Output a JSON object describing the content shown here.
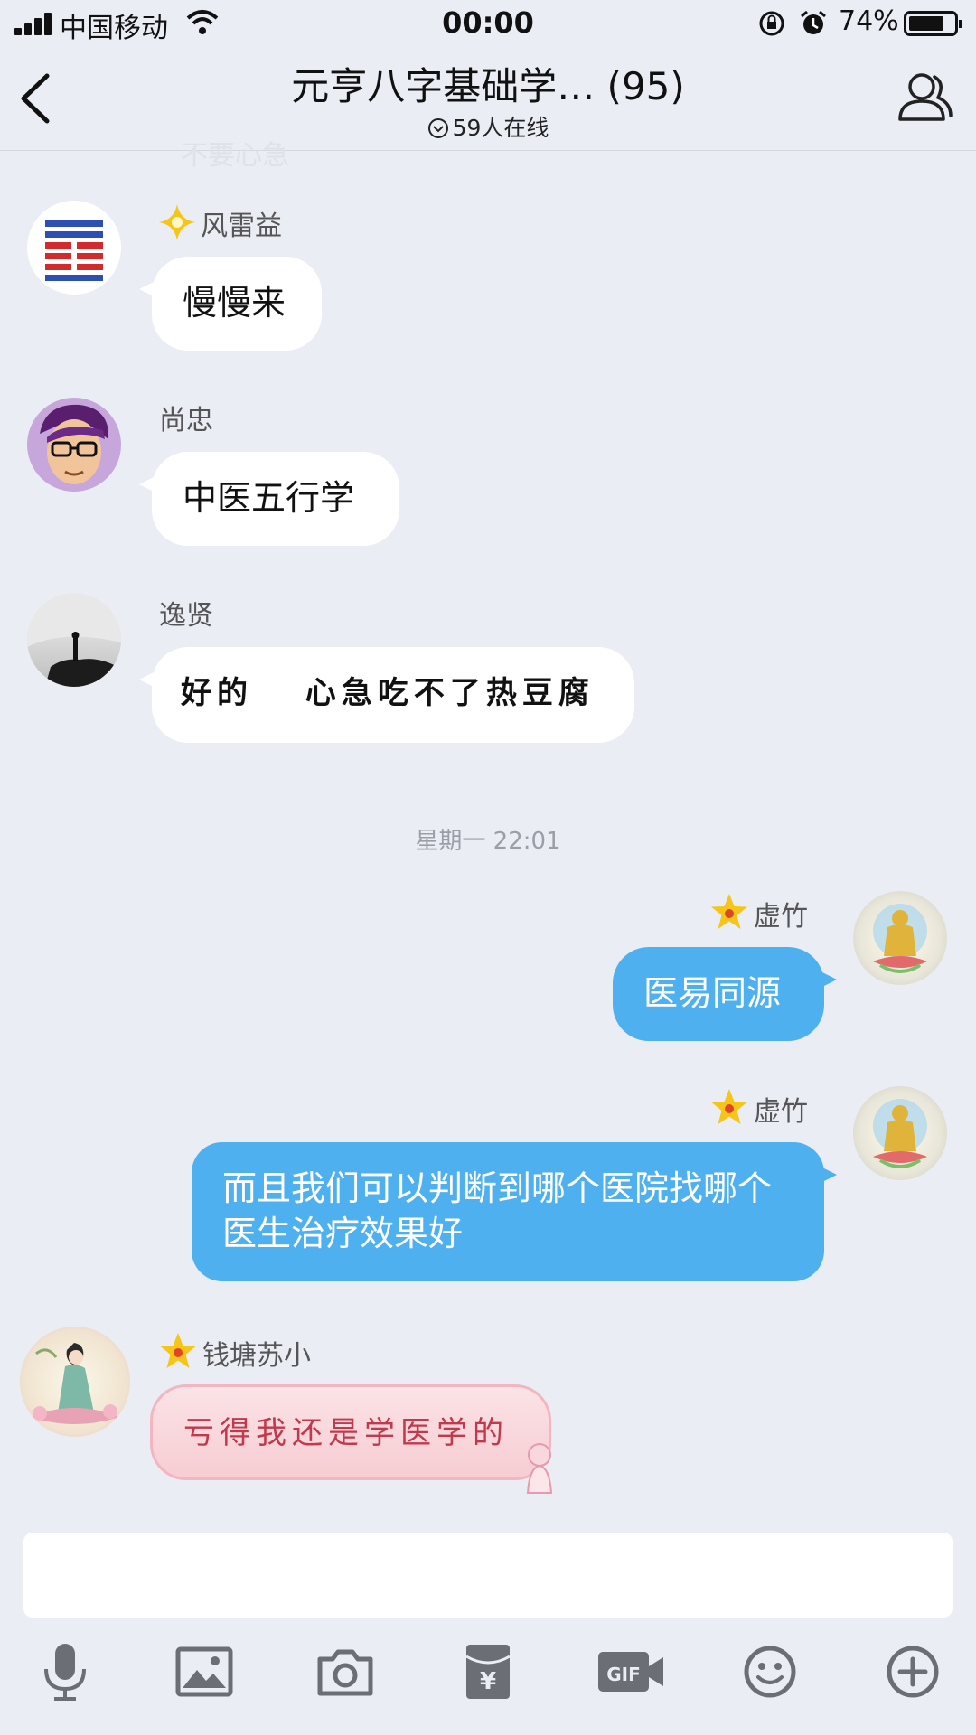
{
  "status_bar": {
    "carrier": "中国移动",
    "time": "00:00",
    "battery_percent": "74%",
    "battery_level": 0.74
  },
  "header": {
    "title": "元亨八字基础学… (95)",
    "online": "59人在线",
    "faded_message": "不要心急"
  },
  "messages": [
    {
      "sender": "风雷益",
      "text": "慢慢来",
      "side": "in",
      "badge": "diamond"
    },
    {
      "sender": "尚忠",
      "text": "中医五行学",
      "side": "in"
    },
    {
      "sender": "逸贤",
      "text": "好的　 心急吃不了热豆腐",
      "side": "in"
    },
    {
      "sender": "虚竹",
      "text": "医易同源",
      "side": "out",
      "badge": "star"
    },
    {
      "sender": "虚竹",
      "text": "而且我们可以判断到哪个医院找哪个医生治疗效果好",
      "side": "out",
      "badge": "star"
    },
    {
      "sender": "钱塘苏小",
      "text": "亏得我还是学医学的",
      "side": "in",
      "badge": "star"
    }
  ],
  "timestamp": "星期一 22:01",
  "input": {
    "value": ""
  },
  "toolbar": [
    "microphone-icon",
    "image-icon",
    "camera-icon",
    "red-packet-icon",
    "gif-icon",
    "emoji-icon",
    "plus-icon"
  ],
  "colors": {
    "outgoing_bubble": "#4fb0ef",
    "background": "#eaedf4",
    "star": "#f5c518"
  }
}
